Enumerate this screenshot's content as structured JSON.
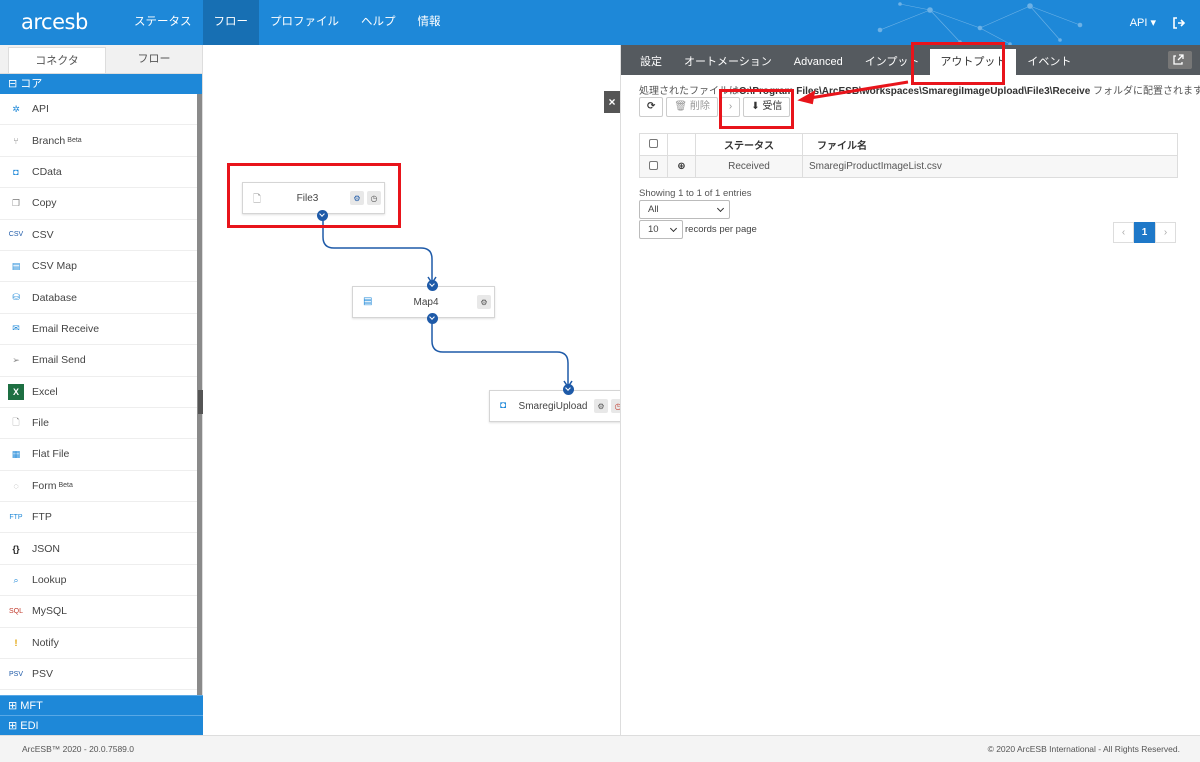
{
  "app": {
    "logo": "arcesb"
  },
  "topnav": [
    {
      "label": "ステータス",
      "active": false
    },
    {
      "label": "フロー",
      "active": true
    },
    {
      "label": "プロファイル",
      "active": false
    },
    {
      "label": "ヘルプ",
      "active": false
    },
    {
      "label": "情報",
      "active": false
    }
  ],
  "topright": {
    "api": "API ▾"
  },
  "sidebar": {
    "tabs": [
      "コネクタ",
      "フロー"
    ],
    "core_group": "⊟ コア",
    "items": [
      {
        "label": "API",
        "beta": ""
      },
      {
        "label": "Branch",
        "beta": "Beta"
      },
      {
        "label": "CData",
        "beta": ""
      },
      {
        "label": "Copy",
        "beta": ""
      },
      {
        "label": "CSV",
        "beta": ""
      },
      {
        "label": "CSV Map",
        "beta": ""
      },
      {
        "label": "Database",
        "beta": ""
      },
      {
        "label": "Email Receive",
        "beta": ""
      },
      {
        "label": "Email Send",
        "beta": ""
      },
      {
        "label": "Excel",
        "beta": ""
      },
      {
        "label": "File",
        "beta": ""
      },
      {
        "label": "Flat File",
        "beta": ""
      },
      {
        "label": "Form",
        "beta": "Beta"
      },
      {
        "label": "FTP",
        "beta": ""
      },
      {
        "label": "JSON",
        "beta": ""
      },
      {
        "label": "Lookup",
        "beta": ""
      },
      {
        "label": "MySQL",
        "beta": ""
      },
      {
        "label": "Notify",
        "beta": ""
      },
      {
        "label": "PSV",
        "beta": ""
      }
    ],
    "bottom_groups": [
      "⊞ MFT",
      "⊞ EDI"
    ]
  },
  "canvas": {
    "nodes": [
      {
        "label": "File3"
      },
      {
        "label": "Map4"
      },
      {
        "label": "SmaregiUpload"
      }
    ],
    "close_label": "×",
    "collapse_label": "‹"
  },
  "panel": {
    "tabs": [
      {
        "label": "設定",
        "active": false
      },
      {
        "label": "オートメーション",
        "active": false
      },
      {
        "label": "Advanced",
        "active": false
      },
      {
        "label": "インプット",
        "active": false
      },
      {
        "label": "アウトプット",
        "active": true
      },
      {
        "label": "イベント",
        "active": false
      }
    ],
    "path_prefix": "処理されたファイルは",
    "path": "C:\\Program Files\\ArcESB\\workspaces\\SmaregiImageUpload\\File3\\Receive",
    "path_suffix": " フォルダに配置されます。",
    "toolbar": {
      "refresh": "⟳",
      "delete": "🗑 削除",
      "more": "›",
      "receive": "⬇ 受信"
    },
    "table": {
      "headers": [
        "ステータス",
        "ファイル名"
      ],
      "rows": [
        {
          "status": "Received",
          "filename": "SmaregiProductImageList.csv"
        }
      ]
    },
    "showing": "Showing 1 to 1 of 1 entries",
    "filter_value": "All",
    "page_size": "10",
    "records_per_page": "records per page",
    "pager": {
      "prev": "‹",
      "current": "1",
      "next": "›"
    }
  },
  "footer": {
    "left": "ArcESB™ 2020 - 20.0.7589.0",
    "right": "© 2020 ArcESB International - All Rights Reserved."
  },
  "colors": {
    "brand": "#1e88d8",
    "annotation": "#e8141b",
    "port": "#1e5aa8"
  }
}
